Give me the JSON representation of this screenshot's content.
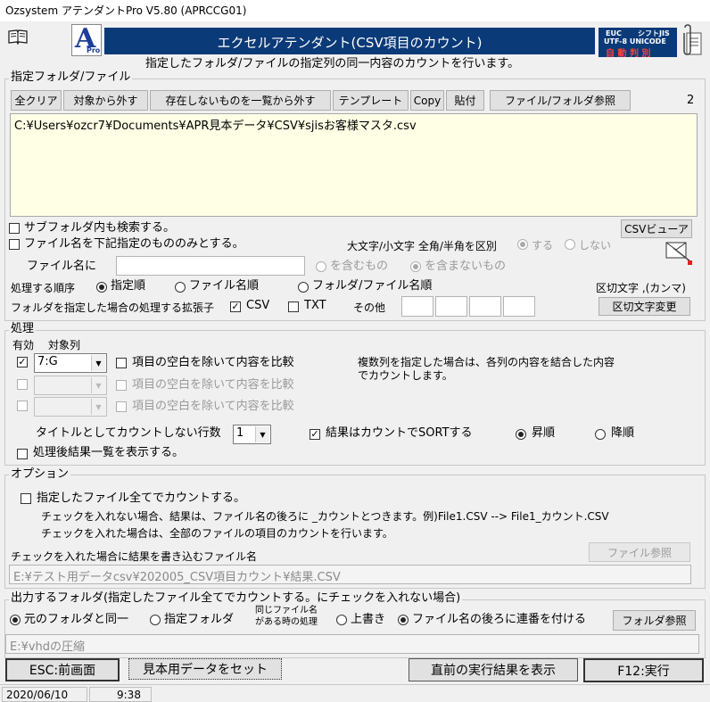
{
  "window": {
    "title": "Ozsystem アテンダントPro V5.80 (APRCCG01)"
  },
  "header": {
    "logo_letter": "A",
    "logo_sub": "Pro",
    "banner_title": "エクセルアテンダント(CSV項目のカウント)",
    "badge_line1_left": "EUC",
    "badge_line1_right": "シフトJIS",
    "badge_line2": "UTF-8 UNICODE",
    "badge_line3": "自 動 判 別",
    "subtitle": "指定したフォルダ/ファイルの指定列の同一内容のカウントを行います。"
  },
  "colors": {
    "banner_bg": "#0b3a78",
    "logo_blue": "#1e3c9a",
    "memo_bg": "#ffffe6"
  },
  "files": {
    "section_title": "指定フォルダ/ファイル",
    "count": "2",
    "toolbar": {
      "clear_all": "全クリア",
      "remove_target": "対象から外す",
      "remove_missing": "存在しないものを一覧から外す",
      "template": "テンプレート",
      "copy": "Copy",
      "paste": "貼付",
      "browse": "ファイル/フォルダ参照"
    },
    "list_text": "C:¥Users¥ozcr7¥Documents¥APR見本データ¥CSV¥sjisお客様マスタ.csv",
    "csv_viewer": "CSVビューア",
    "include_subfolders": "サブフォルダ内も検索する。",
    "filename_filter": "ファイル名を下記指定のもののみとする。",
    "case_label": "大文字/小文字 全角/半角を区別",
    "case_yes": "する",
    "case_no": "しない",
    "filename_label": "ファイル名に",
    "filename_value": "",
    "contains": "を含むもの",
    "not_contains": "を含まないもの",
    "order_label": "処理する順序",
    "order_specified": "指定順",
    "order_filename": "ファイル名順",
    "order_folder_file": "フォルダ/ファイル名順",
    "delimiter_label": "区切文字 ,(カンマ)",
    "ext_label": "フォルダを指定した場合の処理する拡張子",
    "ext_csv": "CSV",
    "ext_txt": "TXT",
    "ext_other": "その他",
    "delimiter_button": "区切文字変更"
  },
  "process": {
    "section_title": "処理",
    "col_enabled": "有効",
    "col_target": "対象列",
    "rows": [
      {
        "enabled": true,
        "column": "7:G",
        "trim_label": "項目の空白を除いて内容を比較"
      },
      {
        "enabled": false,
        "column": "",
        "trim_label": "項目の空白を除いて内容を比較"
      },
      {
        "enabled": false,
        "column": "",
        "trim_label": "項目の空白を除いて内容を比較"
      }
    ],
    "note_line1": "複数列を指定した場合は、各列の内容を結合した内容",
    "note_line2": "でカウントします。",
    "title_rows_label": "タイトルとしてカウントしない行数",
    "title_rows_value": "1",
    "sort_label": "結果はカウントでSORTする",
    "asc": "昇順",
    "desc": "降順",
    "show_result": "処理後結果一覧を表示する。"
  },
  "options": {
    "section_title": "オプション",
    "count_all": "指定したファイル全てでカウントする。",
    "desc1": "チェックを入れない場合、結果は、ファイル名の後ろに _カウントとつきます。例)File1.CSV --> File1_カウント.CSV",
    "desc2": "チェックを入れた場合は、全部のファイルの項目のカウントを行います。",
    "result_file_label": "チェックを入れた場合に結果を書き込むファイル名",
    "browse_file": "ファイル参照",
    "result_file_value": "E:¥テスト用データcsv¥202005_CSV項目カウント¥結果.CSV"
  },
  "output": {
    "section_title": "出力するフォルダ(指定したファイル全てでカウントする。にチェックを入れない場合)",
    "same_folder": "元のフォルダと同一",
    "specified_folder": "指定フォルダ",
    "same_name_line1": "同じファイル名",
    "same_name_line2": "がある時の処理",
    "overwrite": "上書き",
    "add_serial": "ファイル名の後ろに連番を付ける",
    "folder_browse": "フォルダ参照",
    "folder_value": "E:¥vhdの圧縮"
  },
  "footer": {
    "esc": "ESC:前画面",
    "sample": "見本用データをセット",
    "last_result": "直前の実行結果を表示",
    "run": "F12:実行"
  },
  "status": {
    "date": "2020/06/10",
    "time": "9:38"
  }
}
